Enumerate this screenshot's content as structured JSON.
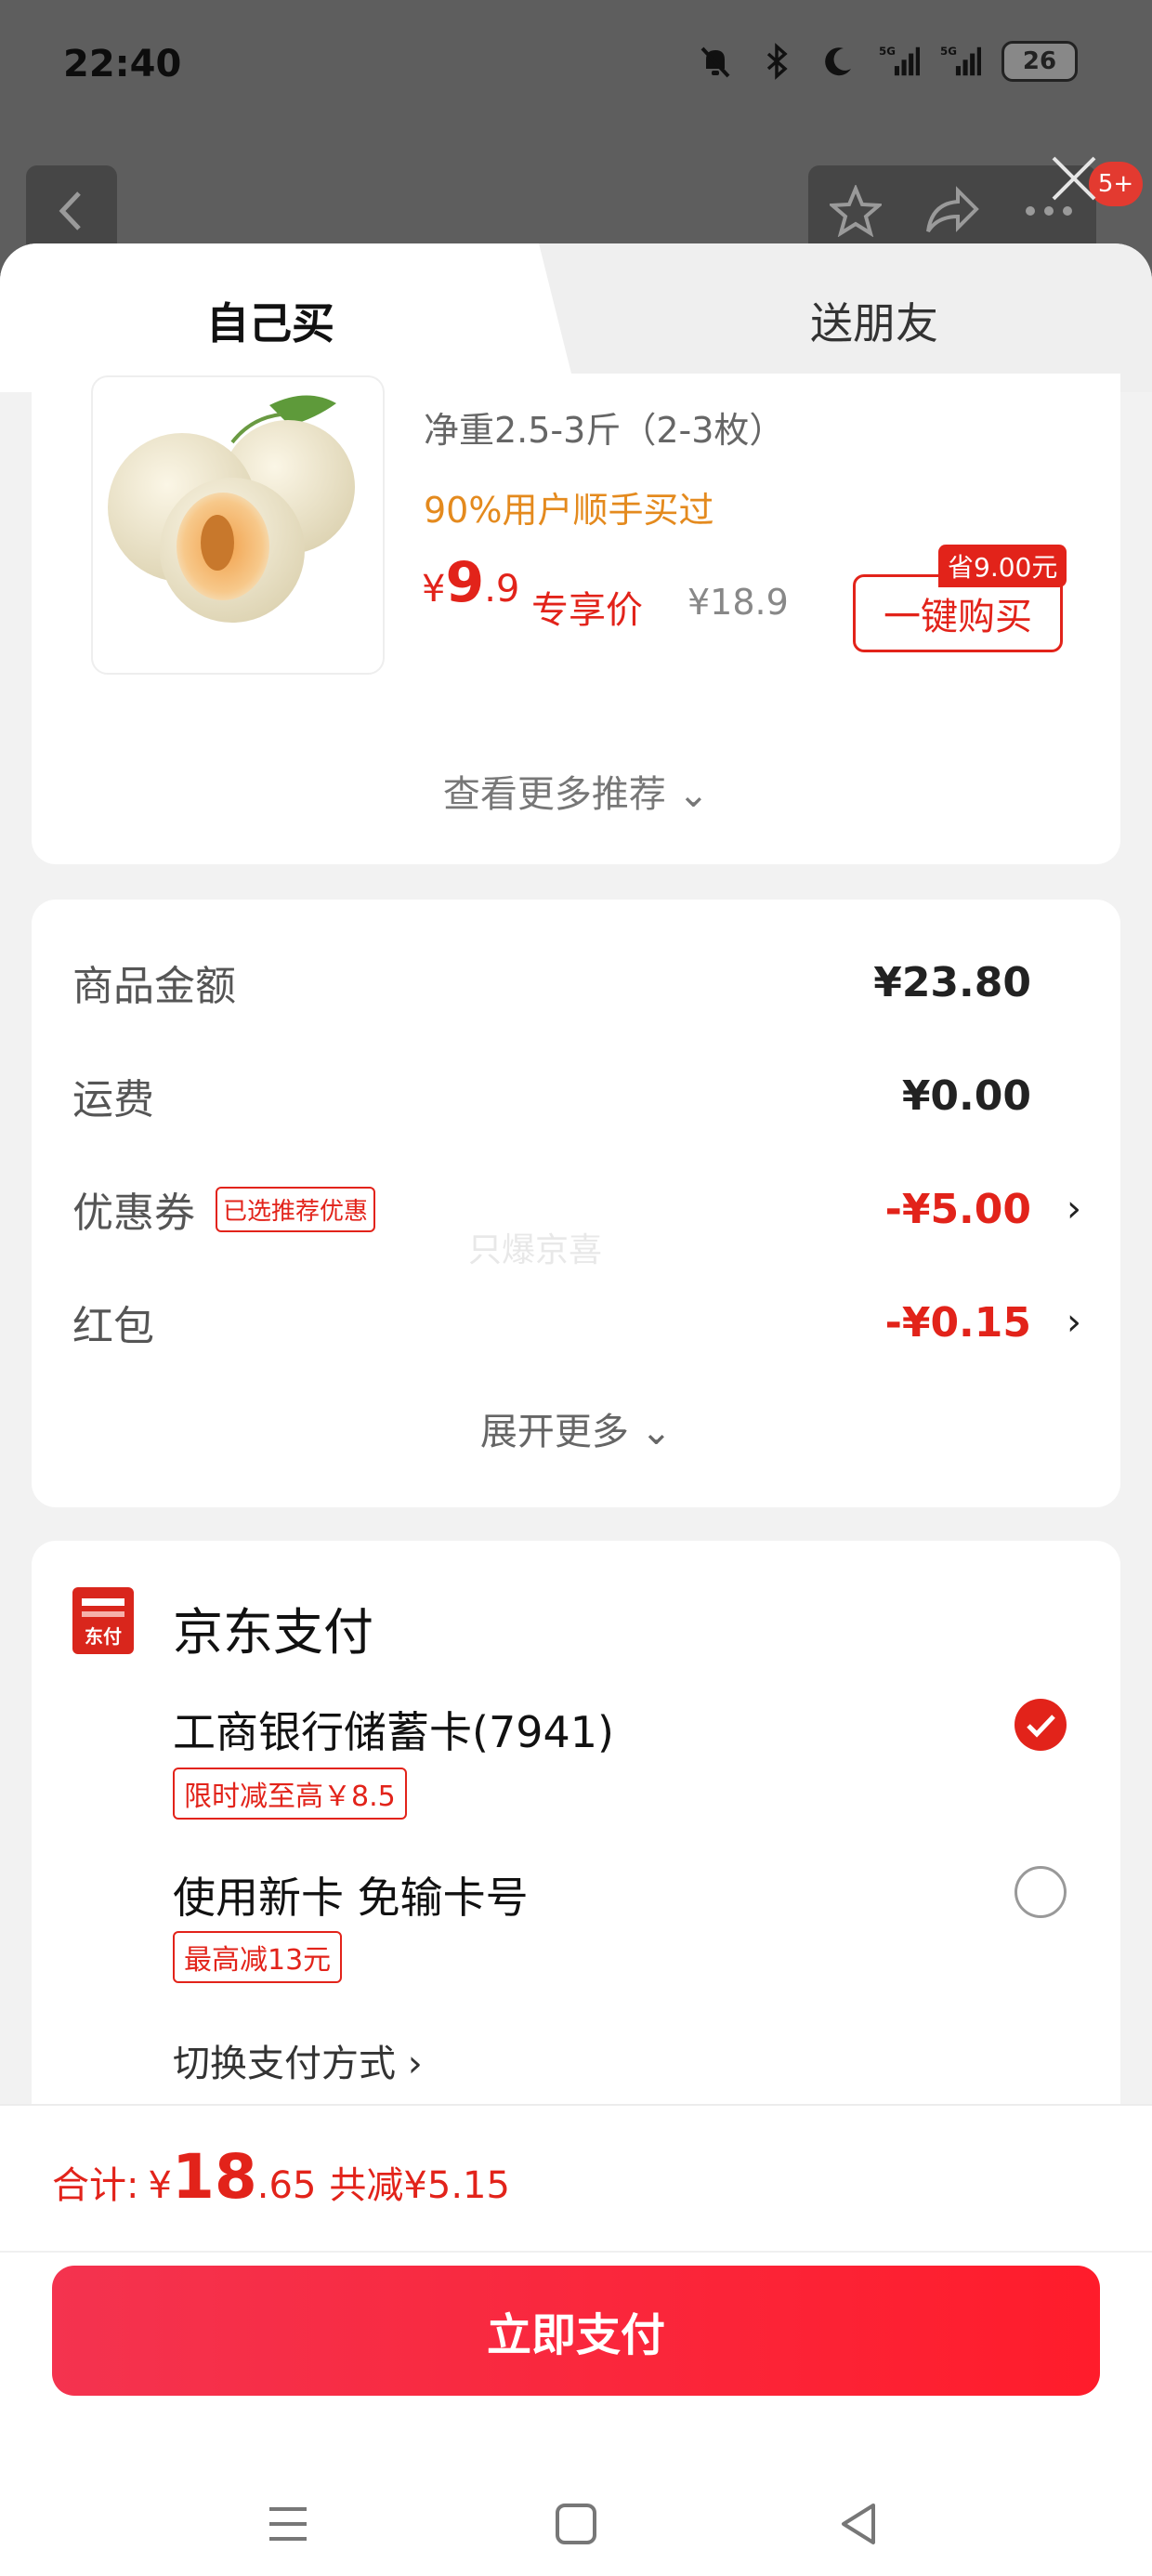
{
  "status_bar": {
    "time": "22:40",
    "battery": "26",
    "signal_1": "5G",
    "signal_2": "5G"
  },
  "background": {
    "notification_count": "5+"
  },
  "tabs": [
    {
      "label": "自己买"
    },
    {
      "label": "送朋友"
    }
  ],
  "product": {
    "spec": "净重2.5-3斤（2-3枚）",
    "bought_hint": "90%用户顺手买过",
    "price_symbol": "¥",
    "price_int": "9",
    "price_dec": ".9",
    "price_tag": "专享价",
    "original_price": "¥18.9",
    "save_tag": "省9.00元",
    "buy_button": "一键购买",
    "more_recommend": "查看更多推荐 ⌄"
  },
  "amounts": {
    "goods_label": "商品金额",
    "goods_value": "¥23.80",
    "shipping_label": "运费",
    "shipping_value": "¥0.00",
    "coupon_label": "优惠券",
    "coupon_tag": "已选推荐优惠",
    "coupon_value": "-¥5.00",
    "redpacket_label": "红包",
    "redpacket_value": "-¥0.15",
    "expand_more": "展开更多 ⌄",
    "watermark": "只爆京喜",
    "accent_color": "#e2231a"
  },
  "payment": {
    "title": "京东支付",
    "logo_text": "东付",
    "method_1": "工商银行储蓄卡(7941)",
    "method_1_promo": "限时减至高￥8.5",
    "method_1_selected": true,
    "method_2": "使用新卡 免输卡号",
    "method_2_promo": "最高减13元",
    "method_2_selected": false,
    "switch_method": "切换支付方式 ›"
  },
  "footer": {
    "total_label": "合计:",
    "total_symbol": "¥",
    "total_int": "18",
    "total_dec": ".65",
    "total_discount": "共减¥5.15",
    "pay_button": "立即支付"
  },
  "icons": {
    "back": "chevron-left-icon",
    "favorite": "star-icon",
    "share": "share-icon",
    "more": "more-icon",
    "close": "close-icon",
    "radio_on": "check-icon",
    "nav_menu": "menu-icon",
    "nav_home": "home-icon",
    "nav_back": "back-icon"
  }
}
